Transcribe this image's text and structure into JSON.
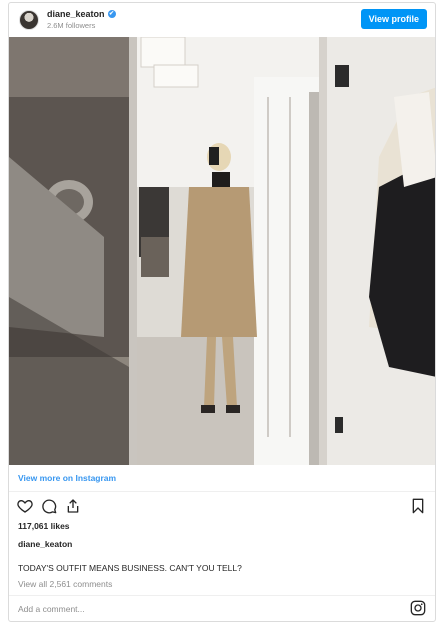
{
  "header": {
    "username": "diane_keaton",
    "verified_mark": "✔",
    "followers": "2.6M followers",
    "view_profile_label": "View profile"
  },
  "post": {
    "image_icon": "photo-mirror-selfie",
    "view_more_label": "View more on Instagram",
    "likes": "117,061 likes",
    "caption_username": "diane_keaton",
    "caption": "TODAY'S OUTFIT MEANS BUSINESS. CAN'T YOU TELL?",
    "comments_link": "View all 2,561 comments",
    "comment_placeholder": "Add a comment..."
  },
  "icons": {
    "like": "heart-icon",
    "comment": "comment-icon",
    "share": "share-icon",
    "save": "bookmark-icon",
    "brand": "instagram-icon"
  },
  "colors": {
    "accent": "#3897f0",
    "button": "#0095f6",
    "text": "#262626",
    "muted": "#8e8e8e"
  }
}
